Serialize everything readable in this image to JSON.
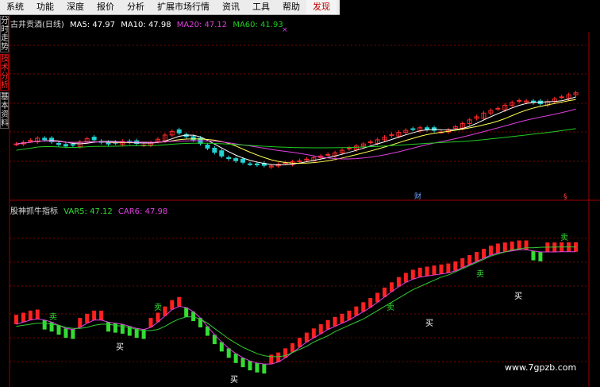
{
  "menubar": {
    "items": [
      "系统",
      "功能",
      "深度",
      "报价",
      "分析",
      "扩展市场行情",
      "资讯",
      "工具",
      "帮助",
      "发现"
    ],
    "active_index": 9
  },
  "side_tabs": [
    {
      "label": "分时走势",
      "selected": false
    },
    {
      "label": "技术分析",
      "selected": true
    },
    {
      "label": "基本资料",
      "selected": false
    }
  ],
  "top_panel": {
    "title": "古井贡酒(日线)",
    "ma5": "MA5: 47.97",
    "ma10": "MA10: 47.98",
    "ma20": "MA20: 47.12",
    "ma60": "MA60: 41.93",
    "marker": "×",
    "event_label": "财",
    "event_label2": "§"
  },
  "bottom_panel": {
    "indicator_name": "股神抓牛指标",
    "var5": "VAR5: 47.12",
    "car6": "CAR6: 47.98",
    "buy_label": "买",
    "sell_label": "卖"
  },
  "watermark": "www.7gpzb.com",
  "colors": {
    "up": "#ff2a2a",
    "down": "#21d3d3",
    "ma5": "#ffffff",
    "ma10": "#ffff55",
    "ma20": "#e040e0",
    "ma60": "#22cc22",
    "grid": "#7a0000",
    "bottom_up": "#ff2020",
    "bottom_down": "#33dd33",
    "var5": "#e040e0",
    "car6": "#33cc33"
  },
  "chart_data": {
    "type": "candlestick",
    "top_close": [
      38.2,
      38.5,
      38.9,
      39.3,
      39.0,
      38.6,
      38.1,
      37.8,
      38.0,
      38.6,
      39.2,
      39.0,
      38.5,
      38.2,
      38.4,
      38.7,
      38.5,
      38.3,
      38.0,
      38.4,
      39.1,
      39.9,
      40.6,
      40.3,
      39.6,
      39.0,
      38.3,
      37.4,
      36.6,
      35.9,
      35.4,
      35.0,
      34.7,
      34.4,
      34.2,
      34.1,
      34.0,
      34.3,
      34.6,
      34.8,
      35.0,
      35.3,
      35.6,
      35.9,
      36.2,
      36.5,
      37.0,
      37.4,
      37.8,
      38.2,
      38.6,
      39.0,
      39.5,
      40.0,
      40.4,
      40.8,
      41.0,
      41.3,
      41.0,
      40.8,
      40.5,
      40.9,
      41.5,
      42.1,
      42.8,
      43.4,
      44.1,
      44.6,
      45.0,
      45.6,
      46.1,
      46.5,
      46.4,
      46.1,
      45.9,
      46.3,
      46.8,
      47.2,
      47.6,
      47.97
    ],
    "bottom_var5": [
      40.2,
      40.4,
      40.6,
      40.7,
      40.6,
      40.4,
      40.1,
      39.8,
      39.7,
      39.9,
      40.3,
      40.6,
      40.6,
      40.4,
      40.3,
      40.2,
      40.0,
      39.8,
      39.7,
      39.9,
      40.4,
      41.0,
      41.6,
      41.9,
      41.8,
      41.4,
      40.8,
      40.0,
      39.2,
      38.5,
      37.9,
      37.4,
      37.0,
      36.7,
      36.5,
      36.4,
      36.4,
      36.6,
      37.0,
      37.5,
      38.0,
      38.5,
      38.9,
      39.3,
      39.7,
      40.0,
      40.3,
      40.6,
      41.0,
      41.4,
      41.8,
      42.3,
      42.8,
      43.3,
      43.8,
      44.2,
      44.5,
      44.7,
      44.8,
      44.9,
      45.0,
      45.1,
      45.3,
      45.6,
      45.9,
      46.2,
      46.5,
      46.8,
      47.0,
      47.1,
      47.2,
      47.3,
      47.3,
      47.2,
      47.1,
      47.1,
      47.1,
      47.12,
      47.12,
      47.12
    ],
    "bottom_car6": [
      40.4,
      40.5,
      40.6,
      40.7,
      40.7,
      40.6,
      40.5,
      40.3,
      40.2,
      40.2,
      40.3,
      40.5,
      40.6,
      40.6,
      40.5,
      40.4,
      40.3,
      40.1,
      40.0,
      40.0,
      40.1,
      40.4,
      40.8,
      41.1,
      41.3,
      41.3,
      41.1,
      40.7,
      40.2,
      39.7,
      39.2,
      38.8,
      38.4,
      38.1,
      37.8,
      37.6,
      37.5,
      37.5,
      37.6,
      37.9,
      38.2,
      38.5,
      38.9,
      39.2,
      39.5,
      39.9,
      40.2,
      40.5,
      40.8,
      41.1,
      41.5,
      41.9,
      42.3,
      42.7,
      43.1,
      43.5,
      43.9,
      44.2,
      44.5,
      44.8,
      45.1,
      45.3,
      45.6,
      45.9,
      46.2,
      46.5,
      46.8,
      47.1,
      47.3,
      47.5,
      47.7,
      47.8,
      47.9,
      47.9,
      47.95,
      47.96,
      47.97,
      47.98,
      47.98,
      47.98
    ]
  }
}
